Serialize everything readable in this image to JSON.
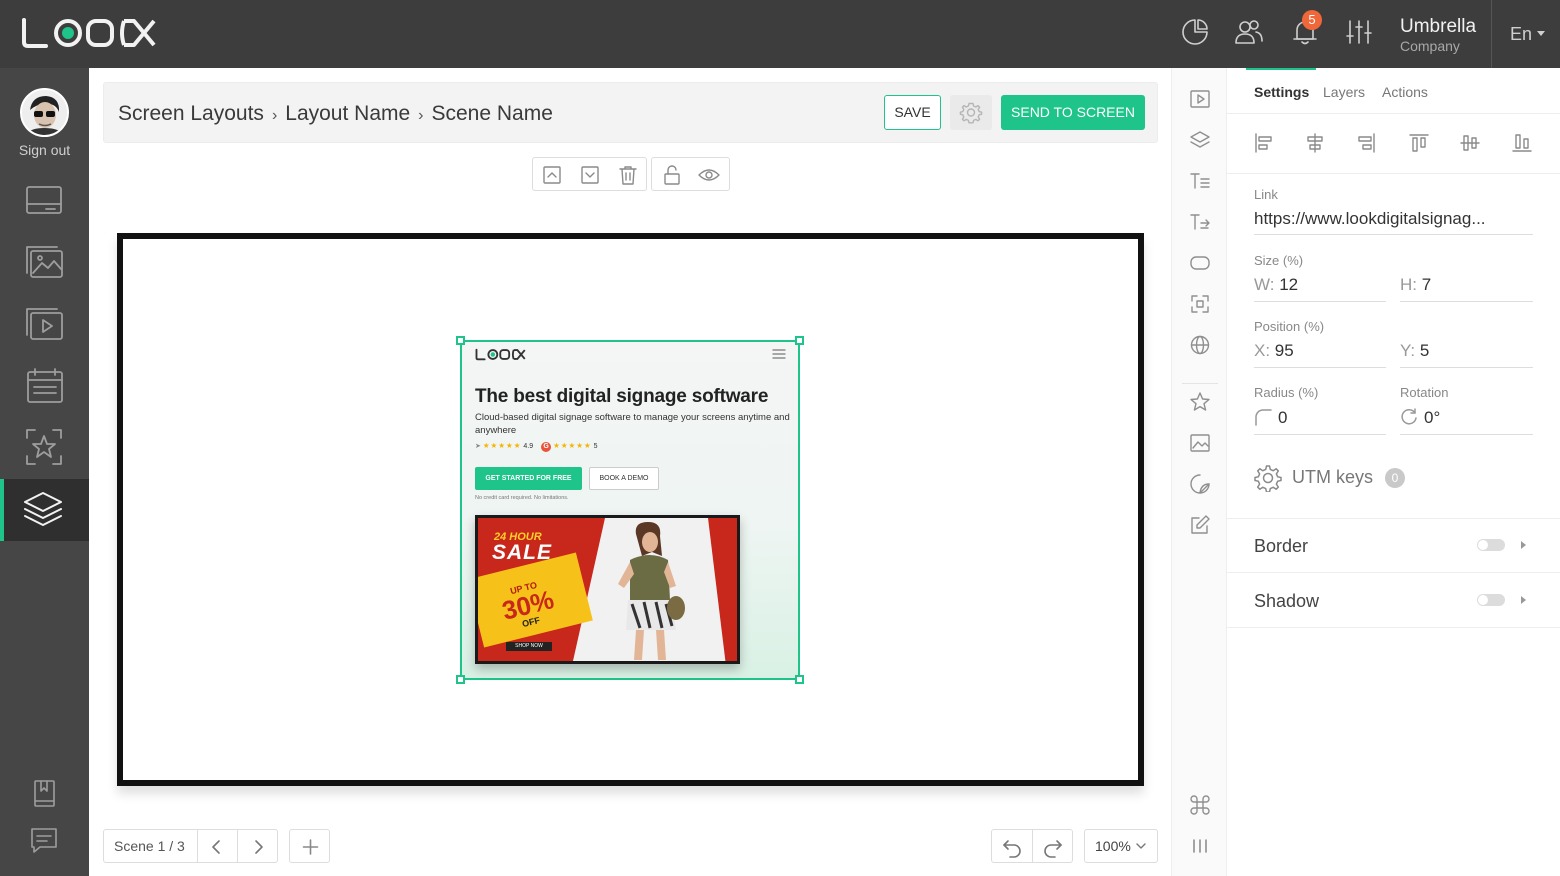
{
  "topbar": {
    "notifications_count": "5",
    "company_name": "Umbrella",
    "company_sub": "Company",
    "language": "En"
  },
  "sidebar": {
    "sign_out_label": "Sign out",
    "items": [
      "screens",
      "media",
      "playlists",
      "schedules",
      "widgets",
      "layouts"
    ],
    "active_item": "layouts"
  },
  "header": {
    "breadcrumb": [
      "Screen Layouts",
      "Layout Name",
      "Scene Name"
    ],
    "separator": "›",
    "save_label": "SAVE",
    "send_label": "SEND TO SCREEN"
  },
  "widget": {
    "title": "The best digital signage software",
    "subtitle": "Cloud-based digital signage software to manage your screens anytime and anywhere",
    "rating_1": "4.9",
    "rating_2": "5",
    "cta_label": "GET STARTED FOR FREE",
    "demo_label": "BOOK A DEMO",
    "note": "No credit card required. No limitations.",
    "tv": {
      "sale_top": "24 HOUR",
      "sale": "SALE",
      "upto": "UP TO",
      "percent": "30%",
      "off": "OFF",
      "shop": "SHOP NOW"
    }
  },
  "footer": {
    "scene_label": "Scene 1 / 3",
    "zoom": "100%"
  },
  "panel": {
    "tabs": [
      "Settings",
      "Layers",
      "Actions"
    ],
    "active_tab": "Settings",
    "link_label": "Link",
    "link_value": "https://www.lookdigitalsignag...",
    "size_label": "Size (%)",
    "w_key": "W:",
    "w_value": "12",
    "h_key": "H:",
    "h_value": "7",
    "position_label": "Position (%)",
    "x_key": "X:",
    "x_value": "95",
    "y_key": "Y:",
    "y_value": "5",
    "radius_label": "Radius (%)",
    "radius_value": "0",
    "rotation_label": "Rotation",
    "rotation_value": "0°",
    "utm_label": "UTM keys",
    "utm_count": "0",
    "border_label": "Border",
    "border_enabled": false,
    "shadow_label": "Shadow",
    "shadow_enabled": false
  },
  "colors": {
    "accent": "#1ec48a",
    "topbar": "#3d3d3d",
    "sidebar": "#464646",
    "badge": "#f0673a"
  }
}
